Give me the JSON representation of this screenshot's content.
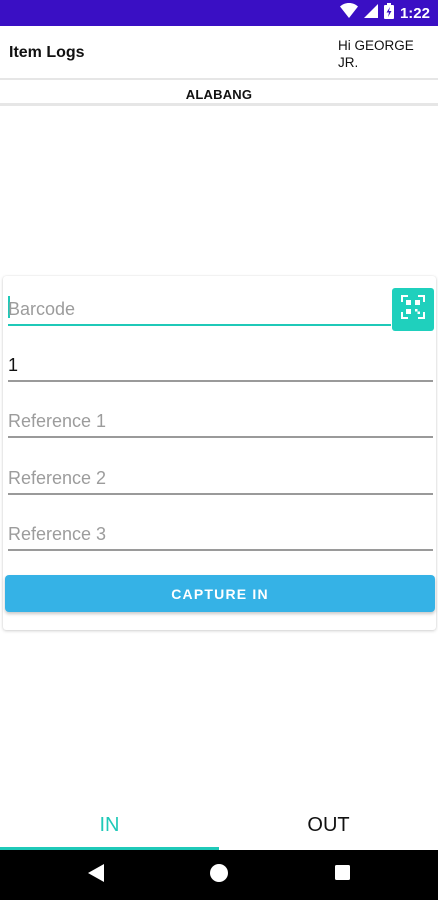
{
  "status_bar": {
    "time": "1:22",
    "icons": [
      "wifi-icon",
      "cellular-signal-icon",
      "battery-charging-icon"
    ],
    "background": "#3a0fc4"
  },
  "header": {
    "title": "Item Logs",
    "greeting": "Hi GEORGE JR."
  },
  "location": {
    "label": "ALABANG"
  },
  "form": {
    "barcode": {
      "value": "",
      "placeholder": "Barcode"
    },
    "quantity": {
      "value": "1",
      "placeholder": ""
    },
    "reference1": {
      "value": "",
      "placeholder": "Reference 1"
    },
    "reference2": {
      "value": "",
      "placeholder": "Reference 2"
    },
    "reference3": {
      "value": "",
      "placeholder": "Reference 3"
    },
    "scan_icon": "qr-scan-icon",
    "capture_button": "CAPTURE IN"
  },
  "tabs": [
    {
      "label": "IN",
      "active": true
    },
    {
      "label": "OUT",
      "active": false
    }
  ],
  "nav_bar": {
    "icons": [
      "back-icon",
      "home-icon",
      "recents-icon"
    ]
  },
  "colors": {
    "accent": "#1fc9b8",
    "primary_button": "#35b2e6",
    "status_bar": "#3a0fc4"
  }
}
